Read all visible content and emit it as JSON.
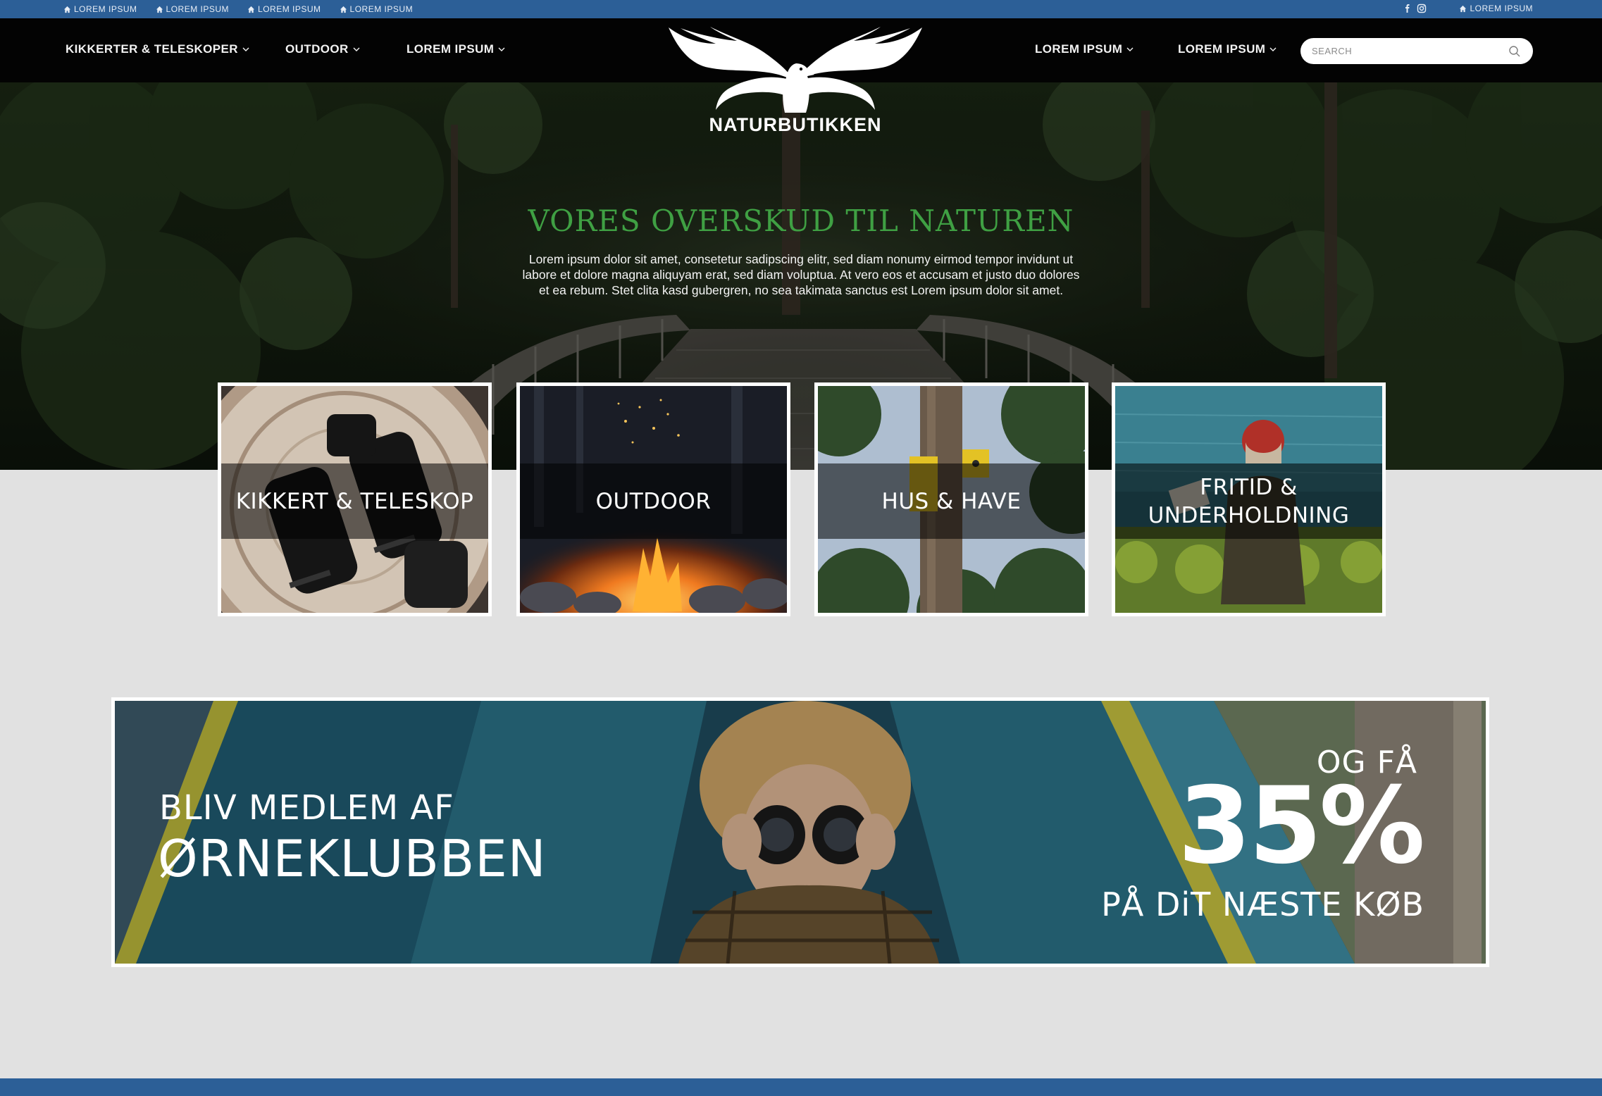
{
  "utility_bar": {
    "links": [
      "LOREM IPSUM",
      "LOREM IPSUM",
      "LOREM IPSUM",
      "LOREM IPSUM"
    ],
    "right_link": "LOREM IPSUM",
    "social_icons": [
      "facebook-icon",
      "instagram-icon"
    ],
    "color": "#2c5f97"
  },
  "nav": {
    "items": [
      {
        "label": "KIKKERTER & TELESKOPER"
      },
      {
        "label": "OUTDOOR"
      },
      {
        "label": "LOREM IPSUM"
      },
      {
        "label": "LOREM IPSUM"
      },
      {
        "label": "LOREM IPSUM"
      }
    ],
    "search_placeholder": "SEARCH"
  },
  "logo": {
    "text": "NATURBUTIKKEN",
    "icon": "eagle-icon"
  },
  "hero": {
    "title": "VORES OVERSKUD TIL NATUREN",
    "title_color": "#3fa043",
    "text_line_1": "Lorem ipsum dolor sit amet, consetetur sadipscing elitr, sed diam nonumy eirmod tempor invidunt ut",
    "text_line_2": "labore et dolore magna aliquyam erat, sed diam voluptua. At vero eos et accusam et justo duo dolores",
    "text_line_3": "et ea rebum. Stet clita kasd gubergren, no sea takimata sanctus est Lorem ipsum dolor sit amet."
  },
  "categories": [
    {
      "label": "KIKKERT & TELESKOP"
    },
    {
      "label": "OUTDOOR"
    },
    {
      "label": "HUS & HAVE"
    },
    {
      "label_line_1": "FRITID &",
      "label_line_2": "UNDERHOLDNING"
    }
  ],
  "banner": {
    "title_line_1": "BLIV MEDLEM AF",
    "title_line_2": "ØRNEKLUBBEN",
    "offer_prefix": "OG FÅ",
    "offer_value": "35%",
    "offer_suffix": "PÅ DiT NÆSTE KØB"
  }
}
